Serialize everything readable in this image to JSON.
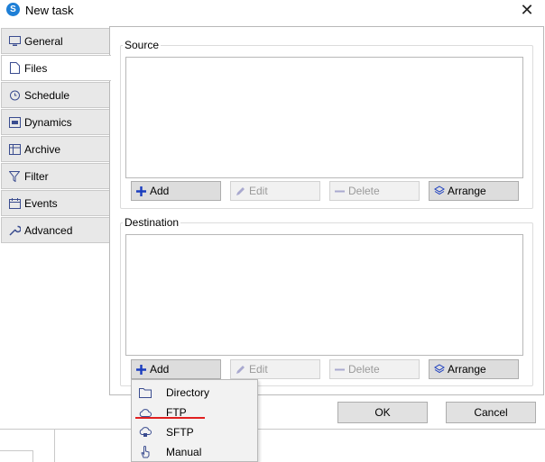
{
  "window": {
    "title": "New task",
    "icon": "app-logo-icon",
    "close": "✕"
  },
  "tabs": [
    {
      "label": "General",
      "icon": "monitor-icon",
      "active": false
    },
    {
      "label": "Files",
      "icon": "file-icon",
      "active": true
    },
    {
      "label": "Schedule",
      "icon": "alarm-clock-icon",
      "active": false
    },
    {
      "label": "Dynamics",
      "icon": "dynamics-icon",
      "active": false
    },
    {
      "label": "Archive",
      "icon": "archive-icon",
      "active": false
    },
    {
      "label": "Filter",
      "icon": "filter-icon",
      "active": false
    },
    {
      "label": "Events",
      "icon": "calendar-icon",
      "active": false
    },
    {
      "label": "Advanced",
      "icon": "wrench-icon",
      "active": false
    }
  ],
  "source": {
    "label": "Source",
    "buttons": {
      "add": "Add",
      "edit": "Edit",
      "delete": "Delete",
      "arrange": "Arrange"
    }
  },
  "destination": {
    "label": "Destination",
    "buttons": {
      "add": "Add",
      "edit": "Edit",
      "delete": "Delete",
      "arrange": "Arrange"
    }
  },
  "dialog": {
    "ok": "OK",
    "cancel": "Cancel"
  },
  "add_menu": {
    "items": [
      {
        "label": "Directory",
        "icon": "folder-icon"
      },
      {
        "label": "FTP",
        "icon": "cloud-icon"
      },
      {
        "label": "SFTP",
        "icon": "cloud-lock-icon"
      },
      {
        "label": "Manual",
        "icon": "hand-pointer-icon"
      }
    ],
    "highlighted": "FTP"
  },
  "colors": {
    "accent": "#1a3dbf",
    "highlight_underline": "#e02020",
    "tab_bg": "#e8e8e8",
    "button_bg": "#dddddd"
  }
}
